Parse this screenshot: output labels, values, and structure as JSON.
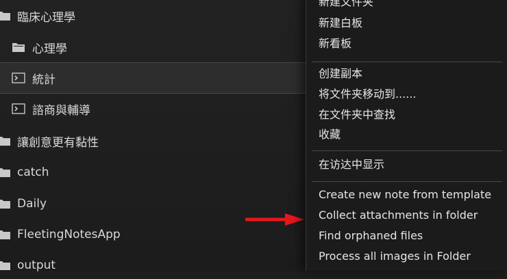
{
  "sidebar": {
    "items": [
      {
        "label": "臨床心理學",
        "icon": "folder-icon"
      },
      {
        "label": "心理學",
        "icon": "folder-icon"
      },
      {
        "label": "統計",
        "icon": "terminal-folder-icon",
        "selected": true
      },
      {
        "label": "諮商與輔導",
        "icon": "terminal-folder-icon"
      },
      {
        "label": "讓創意更有黏性",
        "icon": "folder-icon"
      },
      {
        "label": "catch",
        "icon": "folder-icon"
      },
      {
        "label": "Daily",
        "icon": "folder-icon"
      },
      {
        "label": "FleetingNotesApp",
        "icon": "folder-icon"
      },
      {
        "label": "output",
        "icon": "folder-icon"
      }
    ]
  },
  "context_menu": {
    "items": [
      {
        "label": "新建文件夹"
      },
      {
        "label": "新建白板"
      },
      {
        "label": "新看板"
      },
      {
        "label": "创建副本"
      },
      {
        "label": "将文件夹移动到......"
      },
      {
        "label": "在文件夹中查找"
      },
      {
        "label": "收藏"
      },
      {
        "label": "在访达中显示"
      },
      {
        "label": "Create new note from template"
      },
      {
        "label": "Collect attachments in folder"
      },
      {
        "label": "Find orphaned files"
      },
      {
        "label": "Process all images in Folder"
      }
    ]
  },
  "annotation": {
    "color": "#e8161b",
    "points_to": "Collect attachments in folder"
  }
}
